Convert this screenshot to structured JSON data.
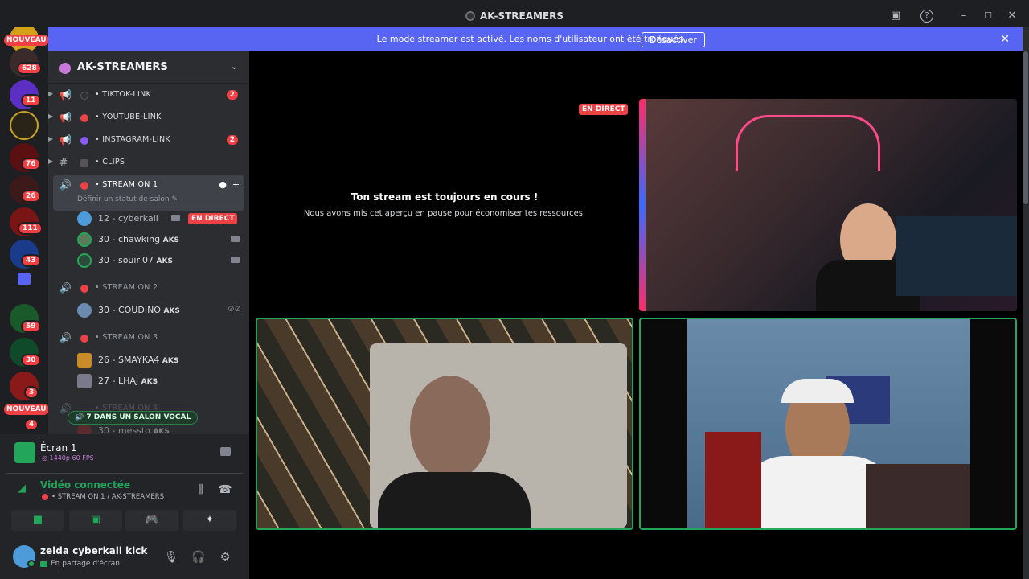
{
  "window": {
    "title": "AK-STREAMERS"
  },
  "banner": {
    "message": "Le mode streamer est activé. Les noms d'utilisateur ont été tronqués.",
    "button": "Désactiver"
  },
  "guilds": {
    "nouveau_top": "NOUVEAU",
    "nouveau_bottom": "NOUVEAU",
    "badges": [
      "628",
      "11",
      "76",
      "26",
      "111",
      "43",
      "59",
      "30",
      "3",
      "4"
    ]
  },
  "server": {
    "name": "AK-STREAMERS"
  },
  "channels": [
    {
      "name": "TIKTOK-LINK",
      "badge": "2",
      "dot": "#2f3136"
    },
    {
      "name": "YOUTUBE-LINK",
      "badge": "",
      "dot": "#ed4245"
    },
    {
      "name": "INSTAGRAM-LINK",
      "badge": "2",
      "dot": "#8a5cf6"
    },
    {
      "name": "CLIPS",
      "badge": "",
      "dot": ""
    }
  ],
  "voice": {
    "stream1": {
      "name": "STREAM ON 1",
      "status": "Définir un statut de salon"
    },
    "stream1_members": [
      {
        "name": "12 - cyberkall",
        "tag": "",
        "live": "EN DIRECT"
      },
      {
        "name": "30 - chawking",
        "tag": "AKS",
        "live": ""
      },
      {
        "name": "30 - souiri07",
        "tag": "AKS",
        "live": ""
      }
    ],
    "stream2": {
      "name": "STREAM ON 2"
    },
    "stream2_members": [
      {
        "name": "30 - COUDINO",
        "tag": "AKS"
      }
    ],
    "stream3": {
      "name": "STREAM ON 3"
    },
    "stream3_members": [
      {
        "name": "26 - SMAYKA4",
        "tag": "AKS"
      },
      {
        "name": "27 - LHAJ",
        "tag": "AKS"
      }
    ],
    "stream4": {
      "name": "STREAM ON 4"
    },
    "stream4_members": [
      {
        "name": "30 - messto",
        "tag": "AKS"
      }
    ],
    "pill": "7 DANS UN SALON VOCAL"
  },
  "panel": {
    "screen_title": "Écran 1",
    "screen_quality": "1440p 60 FPS",
    "connected": "Vidéo connectée",
    "connected_channel": "STREAM ON 1 / AK-STREAMERS",
    "username": "zelda cyberkall kick",
    "user_status": "En partage d'écran"
  },
  "stage": {
    "paused_title": "Ton stream est toujours en cours !",
    "paused_sub": "Nous avons mis cet aperçu en pause pour économiser tes ressources.",
    "live_label": "EN DIRECT"
  }
}
